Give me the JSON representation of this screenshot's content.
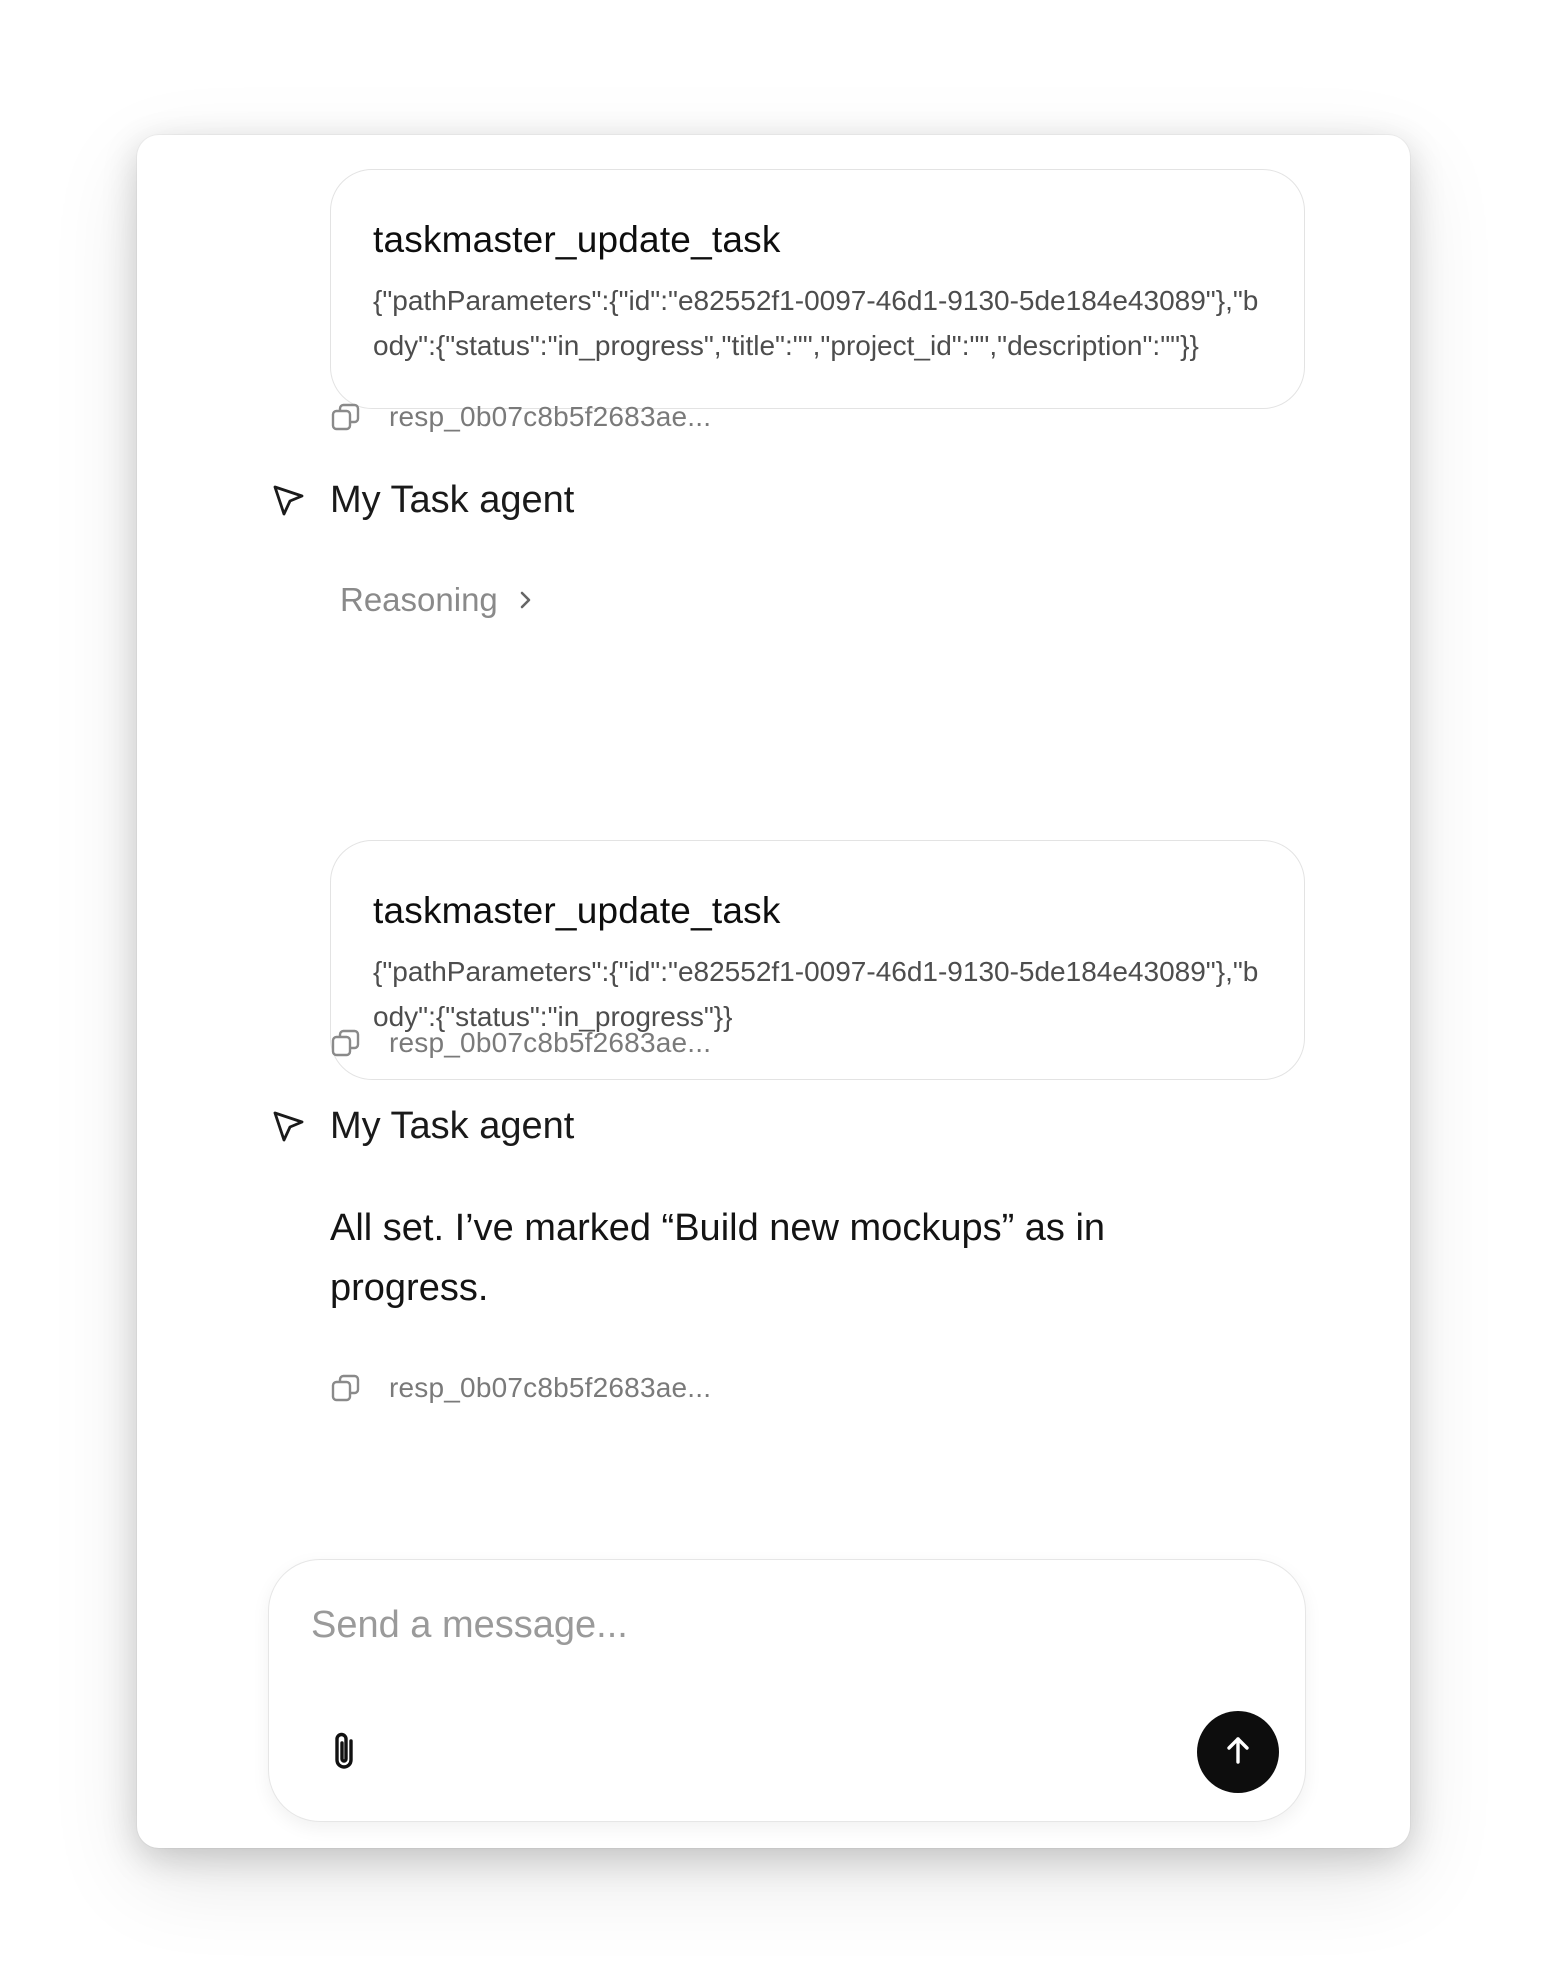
{
  "thread": {
    "tool_calls": [
      {
        "name": "taskmaster_update_task",
        "args": "{\"pathParameters\":{\"id\":\"e82552f1-0097-46d1-9130-5de184e43089\"},\"body\":{\"status\":\"in_progress\",\"title\":\"\",\"project_id\":\"\",\"description\":\"\"}}"
      },
      {
        "name": "taskmaster_update_task",
        "args": "{\"pathParameters\":{\"id\":\"e82552f1-0097-46d1-9130-5de184e43089\"},\"body\":{\"status\":\"in_progress\"}}"
      }
    ],
    "response_ids": [
      "resp_0b07c8b5f2683ae...",
      "resp_0b07c8b5f2683ae...",
      "resp_0b07c8b5f2683ae..."
    ],
    "agent_name": "My Task agent",
    "reasoning_label": "Reasoning",
    "final_message": "All set. I’ve marked “Build new mockups” as in progress."
  },
  "composer": {
    "placeholder": "Send a message...",
    "value": ""
  },
  "icons": {
    "copy": "copy-icon",
    "agent": "cursor-arrow-icon",
    "reasoning": "chevron-right-icon",
    "attach": "paperclip-icon",
    "send": "arrow-up-icon"
  },
  "colors": {
    "send_button_bg": "#0d0d0d",
    "muted_text": "#7a7a7a",
    "card_border": "#e3e3e3"
  }
}
